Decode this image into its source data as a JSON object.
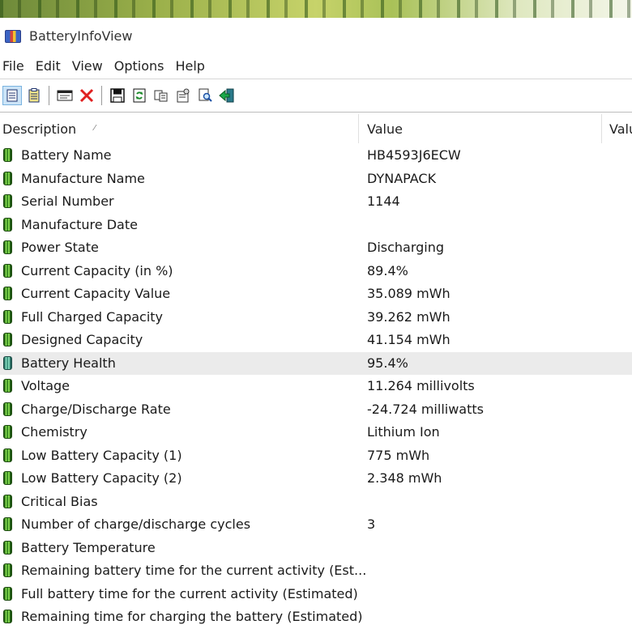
{
  "window": {
    "title": "BatteryInfoView"
  },
  "menu": [
    "File",
    "Edit",
    "View",
    "Options",
    "Help"
  ],
  "toolbar": {
    "icons": [
      "basic-info-icon",
      "advanced-info-icon",
      "properties-window-icon",
      "delete-icon",
      "save-icon",
      "refresh-icon",
      "copy-icon",
      "options-icon",
      "find-icon",
      "exit-icon"
    ]
  },
  "columns": {
    "description": "Description",
    "value": "Value",
    "value2": "Valu"
  },
  "rows": [
    {
      "description": "Battery Name",
      "value": "HB4593J6ECW"
    },
    {
      "description": "Manufacture Name",
      "value": "DYNAPACK"
    },
    {
      "description": "Serial Number",
      "value": "1144"
    },
    {
      "description": "Manufacture Date",
      "value": ""
    },
    {
      "description": "Power State",
      "value": "Discharging"
    },
    {
      "description": "Current Capacity (in %)",
      "value": "89.4%"
    },
    {
      "description": "Current Capacity Value",
      "value": "35.089 mWh"
    },
    {
      "description": "Full Charged Capacity",
      "value": "39.262 mWh"
    },
    {
      "description": "Designed Capacity",
      "value": "41.154 mWh"
    },
    {
      "description": "Battery Health",
      "value": "95.4%",
      "selected": true
    },
    {
      "description": "Voltage",
      "value": "11.264 millivolts"
    },
    {
      "description": "Charge/Discharge Rate",
      "value": "-24.724 milliwatts"
    },
    {
      "description": "Chemistry",
      "value": "Lithium Ion"
    },
    {
      "description": "Low Battery Capacity (1)",
      "value": "775 mWh"
    },
    {
      "description": "Low Battery Capacity (2)",
      "value": "2.348 mWh"
    },
    {
      "description": "Critical Bias",
      "value": ""
    },
    {
      "description": "Number of charge/discharge cycles",
      "value": "3"
    },
    {
      "description": "Battery Temperature",
      "value": ""
    },
    {
      "description": "Remaining battery time for the current activity (Est...",
      "value": ""
    },
    {
      "description": "Full battery time for the current activity (Estimated)",
      "value": ""
    },
    {
      "description": "Remaining time for charging the battery (Estimated)",
      "value": ""
    }
  ],
  "colors": {
    "selected_row": "#ebebeb",
    "accent": "#7ab3e0"
  }
}
